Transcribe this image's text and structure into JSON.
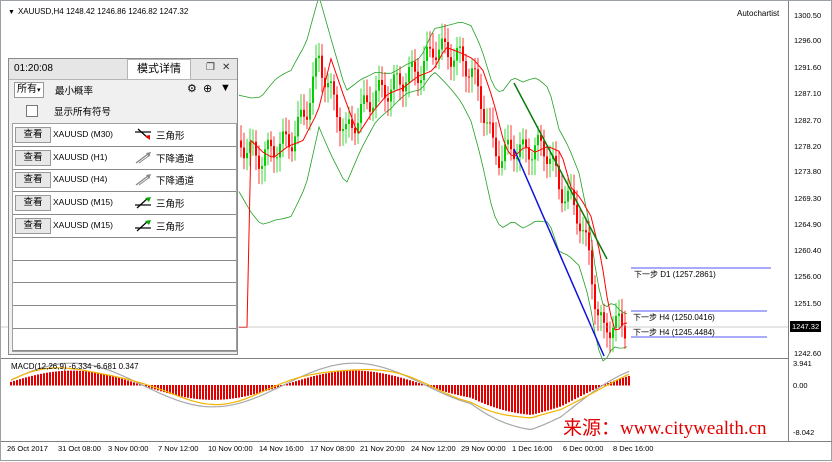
{
  "chart": {
    "symbol_label": "XAUUSD,H4  1248.42 1246.86 1246.82 1247.32",
    "autochartist_label": "Autochartist",
    "price_ticks": [
      "1300.50",
      "1296.00",
      "1291.60",
      "1287.10",
      "1282.70",
      "1278.20",
      "1273.80",
      "1269.30",
      "1264.90",
      "1260.40",
      "1256.00",
      "1251.50",
      "1247.32",
      "1242.60"
    ],
    "current_price": "1247.32",
    "levels": [
      {
        "label": "下一步 D1 (1257.2861)",
        "color": "#22b022"
      },
      {
        "label": "下一步 H4 (1250.0416)",
        "color": "#1b1bf0"
      },
      {
        "label": "下一步 H4 (1245.4484)",
        "color": "#1b1bf0"
      }
    ],
    "macd_label": "MACD(12,26,9) -6.334 -6.681 0.347",
    "macd_ticks": [
      "3.941",
      "0.00",
      "-8.042"
    ],
    "time_labels": [
      "26 Oct 2017",
      "31 Oct 08:00",
      "3 Nov 00:00",
      "7 Nov 12:00",
      "10 Nov 00:00",
      "14 Nov 16:00",
      "17 Nov 08:00",
      "21 Nov 20:00",
      "24 Nov 12:00",
      "29 Nov 00:00",
      "1 Dec 16:00",
      "6 Dec 00:00",
      "8 Dec 16:00"
    ],
    "watermark": "来源：www.citywealth.cn",
    "colors": {
      "up": "#00d000",
      "down": "#ff0000",
      "ma": "#ff0000",
      "band": "#22a022",
      "trend_upper": "#0a7a0a",
      "trend_lower": "#1010e0"
    }
  },
  "panel": {
    "time": "01:20:08",
    "title": "模式详情",
    "scope_select": "所有",
    "min_prob_label": "最小概率",
    "show_all_label": "显示所有符号",
    "view_label": "查看",
    "rows": [
      {
        "symbol": "XAUUSD (M30)",
        "pattern": "三角形",
        "icon": "triangle-down-icon"
      },
      {
        "symbol": "XAUUSD (H1)",
        "pattern": "下降通道",
        "icon": "channel-icon"
      },
      {
        "symbol": "XAUUSD (H4)",
        "pattern": "下降通道",
        "icon": "channel-icon"
      },
      {
        "symbol": "XAUUSD (M15)",
        "pattern": "三角形",
        "icon": "triangle-up-icon"
      },
      {
        "symbol": "XAUUSD (M15)",
        "pattern": "三角形",
        "icon": "triangle-up-icon"
      }
    ]
  }
}
